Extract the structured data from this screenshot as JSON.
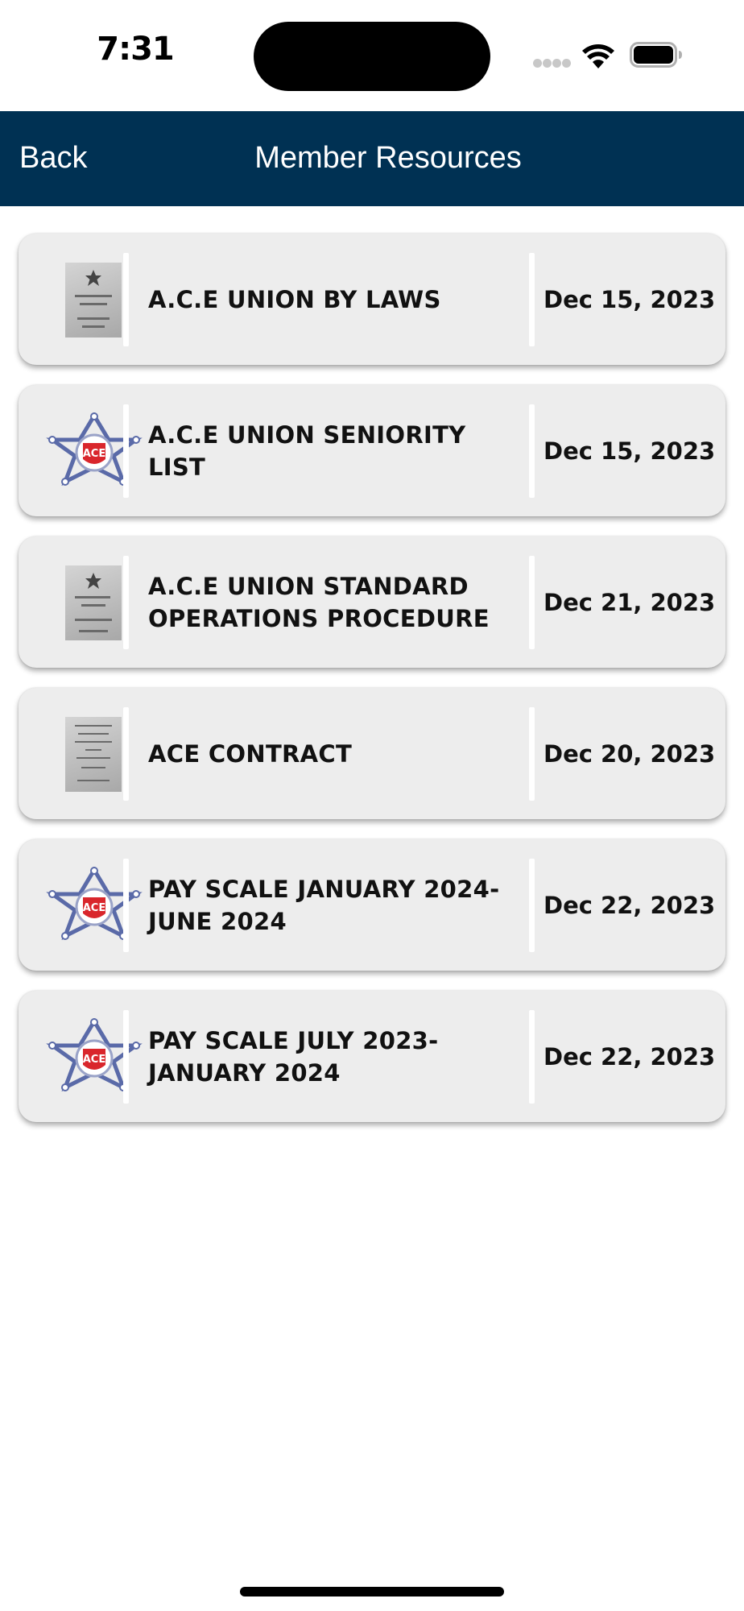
{
  "status_bar": {
    "time": "7:31"
  },
  "nav": {
    "back_label": "Back",
    "title": "Member Resources",
    "background_color": "#003153"
  },
  "resources": [
    {
      "title": "A.C.E UNION BY LAWS",
      "date": "Dec 15, 2023",
      "thumbnail": "document-cover-icon"
    },
    {
      "title": "A.C.E UNION SENIORITY LIST",
      "date": "Dec 15, 2023",
      "thumbnail": "union-badge-icon"
    },
    {
      "title": "A.C.E UNION STANDARD OPERATIONS PROCEDURE",
      "date": "Dec 21, 2023",
      "thumbnail": "document-cover-icon"
    },
    {
      "title": "ACE CONTRACT",
      "date": "Dec 20, 2023",
      "thumbnail": "document-cover-icon"
    },
    {
      "title": "PAY SCALE JANUARY 2024-JUNE 2024",
      "date": "Dec 22, 2023",
      "thumbnail": "union-badge-icon"
    },
    {
      "title": "PAY SCALE JULY 2023-JANUARY 2024",
      "date": "Dec 22, 2023",
      "thumbnail": "union-badge-icon"
    }
  ]
}
